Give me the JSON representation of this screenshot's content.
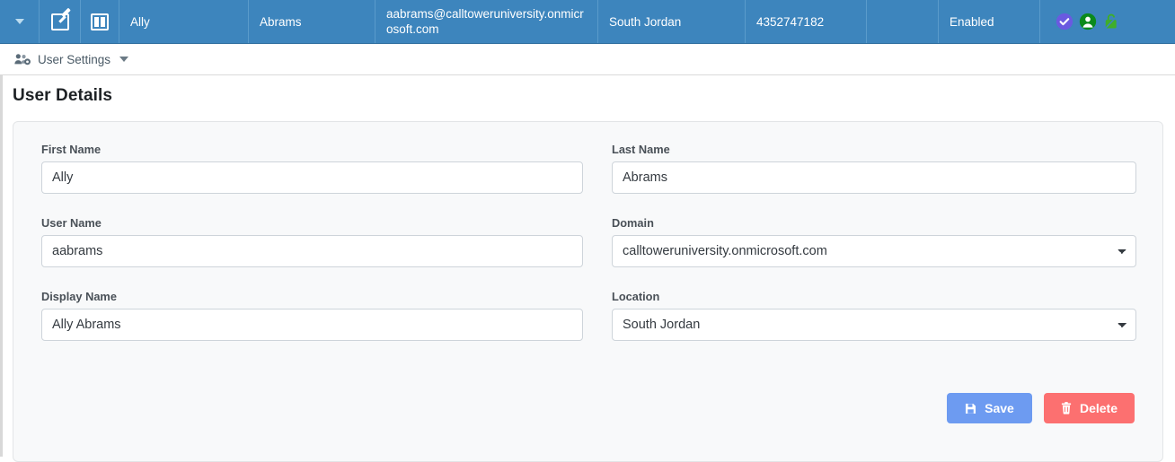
{
  "topbar": {
    "caret_icon": "chevron-down-icon",
    "edit_icon": "edit-square-icon",
    "columns_icon": "columns-icon",
    "first_name": "Ally",
    "last_name": "Abrams",
    "email": "aabrams@calltoweruniversity.onmicrosoft.com",
    "location": "South Jordan",
    "phone": "4352747182",
    "blank": "",
    "status": "Enabled",
    "badges": [
      {
        "name": "check-circle-icon",
        "color": "#6a5ae0"
      },
      {
        "name": "user-circle-icon",
        "color": "#0b8a1c"
      },
      {
        "name": "unlock-icon",
        "color": "#3fae2a"
      }
    ],
    "background": "#3d85bd"
  },
  "subbar": {
    "icon": "users-cog-icon",
    "label": "User Settings",
    "caret_icon": "caret-down-icon"
  },
  "page": {
    "title": "User Details"
  },
  "form": {
    "first_name": {
      "label": "First Name",
      "value": "Ally",
      "placeholder": ""
    },
    "last_name": {
      "label": "Last Name",
      "value": "Abrams",
      "placeholder": ""
    },
    "user_name": {
      "label": "User Name",
      "value": "aabrams",
      "placeholder": ""
    },
    "domain": {
      "label": "Domain",
      "value": "calltoweruniversity.onmicrosoft.com",
      "options": [
        "calltoweruniversity.onmicrosoft.com"
      ]
    },
    "display_name": {
      "label": "Display Name",
      "value": "Ally Abrams",
      "placeholder": ""
    },
    "location": {
      "label": "Location",
      "value": "South Jordan",
      "options": [
        "South Jordan"
      ]
    }
  },
  "actions": {
    "save": {
      "label": "Save",
      "icon": "save-icon",
      "color": "#6d9bf1"
    },
    "delete": {
      "label": "Delete",
      "icon": "trash-icon",
      "color": "#fc7070"
    }
  }
}
